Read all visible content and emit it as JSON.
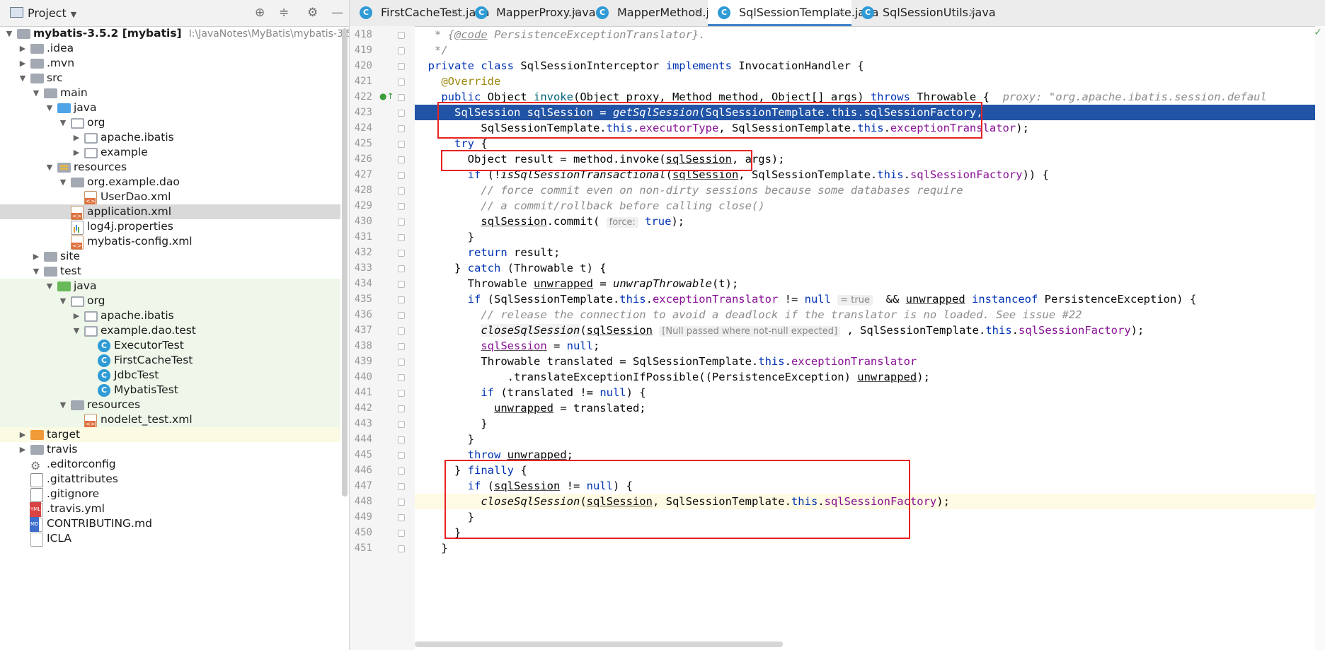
{
  "project_panel": {
    "title": "Project",
    "tree": [
      {
        "label": "mybatis-3.5.2 [mybatis]",
        "extra": "I:\\JavaNotes\\MyBatis\\mybatis-3.5.",
        "depth": 0,
        "state": "open",
        "icon": "module-folder-icon"
      },
      {
        "label": ".idea",
        "depth": 1,
        "state": "closed",
        "icon": "folder-icon"
      },
      {
        "label": ".mvn",
        "depth": 1,
        "state": "closed",
        "icon": "folder-icon"
      },
      {
        "label": "src",
        "depth": 1,
        "state": "open",
        "icon": "folder-icon"
      },
      {
        "label": "main",
        "depth": 2,
        "state": "open",
        "icon": "folder-icon"
      },
      {
        "label": "java",
        "depth": 3,
        "state": "open",
        "icon": "source-folder-icon"
      },
      {
        "label": "org",
        "depth": 4,
        "state": "open",
        "icon": "package-icon"
      },
      {
        "label": "apache.ibatis",
        "depth": 5,
        "state": "closed",
        "icon": "package-icon"
      },
      {
        "label": "example",
        "depth": 5,
        "state": "closed",
        "icon": "package-icon"
      },
      {
        "label": "resources",
        "depth": 3,
        "state": "open",
        "icon": "resources-folder-icon"
      },
      {
        "label": "org.example.dao",
        "depth": 4,
        "state": "open",
        "icon": "folder-icon"
      },
      {
        "label": "UserDao.xml",
        "depth": 5,
        "state": "leaf",
        "icon": "xml-file-icon"
      },
      {
        "label": "application.xml",
        "depth": 4,
        "state": "leaf",
        "icon": "xml-file-icon",
        "selected": true
      },
      {
        "label": "log4j.properties",
        "depth": 4,
        "state": "leaf",
        "icon": "properties-file-icon"
      },
      {
        "label": "mybatis-config.xml",
        "depth": 4,
        "state": "leaf",
        "icon": "xml-file-icon"
      },
      {
        "label": "site",
        "depth": 2,
        "state": "closed",
        "icon": "folder-icon"
      },
      {
        "label": "test",
        "depth": 2,
        "state": "open",
        "icon": "folder-icon"
      },
      {
        "label": "java",
        "depth": 3,
        "state": "open",
        "icon": "test-folder-icon",
        "green": true
      },
      {
        "label": "org",
        "depth": 4,
        "state": "open",
        "icon": "package-icon",
        "green": true
      },
      {
        "label": "apache.ibatis",
        "depth": 5,
        "state": "closed",
        "icon": "package-icon",
        "green": true
      },
      {
        "label": "example.dao.test",
        "depth": 5,
        "state": "open",
        "icon": "package-icon",
        "green": true
      },
      {
        "label": "ExecutorTest",
        "depth": 6,
        "state": "leaf",
        "icon": "class-icon",
        "green": true
      },
      {
        "label": "FirstCacheTest",
        "depth": 6,
        "state": "leaf",
        "icon": "class-icon",
        "green": true
      },
      {
        "label": "JdbcTest",
        "depth": 6,
        "state": "leaf",
        "icon": "class-icon",
        "green": true
      },
      {
        "label": "MybatisTest",
        "depth": 6,
        "state": "leaf",
        "icon": "class-icon",
        "green": true
      },
      {
        "label": "resources",
        "depth": 4,
        "state": "open",
        "icon": "folder-icon",
        "green": true
      },
      {
        "label": "nodelet_test.xml",
        "depth": 5,
        "state": "leaf",
        "icon": "xml-file-icon",
        "green": true
      },
      {
        "label": "target",
        "depth": 1,
        "state": "closed",
        "icon": "excluded-folder-icon",
        "yellow": true
      },
      {
        "label": "travis",
        "depth": 1,
        "state": "closed",
        "icon": "folder-icon"
      },
      {
        "label": ".editorconfig",
        "depth": 1,
        "state": "leaf",
        "icon": "gear-icon"
      },
      {
        "label": ".gitattributes",
        "depth": 1,
        "state": "leaf",
        "icon": "git-file-icon"
      },
      {
        "label": ".gitignore",
        "depth": 1,
        "state": "leaf",
        "icon": "git-file-icon"
      },
      {
        "label": ".travis.yml",
        "depth": 1,
        "state": "leaf",
        "icon": "yml-file-icon"
      },
      {
        "label": "CONTRIBUTING.md",
        "depth": 1,
        "state": "leaf",
        "icon": "md-file-icon"
      },
      {
        "label": "ICLA",
        "depth": 1,
        "state": "leaf",
        "icon": "text-file-icon"
      }
    ]
  },
  "tabs": [
    {
      "label": "FirstCacheTest.java",
      "active": false
    },
    {
      "label": "MapperProxy.java",
      "active": false
    },
    {
      "label": "MapperMethod.java",
      "active": false
    },
    {
      "label": "SqlSessionTemplate.java",
      "active": true
    },
    {
      "label": "SqlSessionUtils.java",
      "active": false
    }
  ],
  "code_lines": [
    {
      "n": "418",
      "html": "   <span class='doc'>* {</span><span class='docref'>@code</span><span class='doc'> PersistenceExceptionTranslator}.</span>"
    },
    {
      "n": "419",
      "html": "   <span class='doc'>*/</span>"
    },
    {
      "n": "420",
      "html": "  <span class='kw'>private class</span> SqlSessionInterceptor <span class='kw'>implements</span> InvocationHandler {"
    },
    {
      "n": "421",
      "html": "    <span class='an'>@Override</span>"
    },
    {
      "n": "422",
      "html": "    <span class='kw'>public</span> Object <span style='color:#00627a'>invoke</span>(Object proxy, Method method, Object[] args) <span class='kw'>throws</span> Throwable {  <span class='inl'>proxy: \"org.apache.ibatis.session.defaul</span>"
    },
    {
      "n": "423",
      "html": "      SqlSession <span class='u'>sqlSession</span> = <span class='it'>getSqlSession</span>(SqlSessionTemplate.this.sqlSessionFactory,",
      "hl": true
    },
    {
      "n": "424",
      "html": "          SqlSessionTemplate.<span class='kw'>this</span>.<span class='fld'>executorType</span>, SqlSessionTemplate.<span class='kw'>this</span>.<span class='fld'>exceptionTranslator</span>);"
    },
    {
      "n": "425",
      "html": "      <span class='kw'>try</span> {"
    },
    {
      "n": "426",
      "html": "        Object result = method.invoke(<span class='u'>sqlSession</span>, args);"
    },
    {
      "n": "427",
      "html": "        <span class='kw'>if</span> (!<span class='it'>isSqlSessionTransactional</span>(<span class='u'>sqlSession</span>, SqlSessionTemplate.<span class='kw'>this</span>.<span class='fld'>sqlSessionFactory</span>)) {"
    },
    {
      "n": "428",
      "html": "          <span class='cm'>// force commit even on non-dirty sessions because some databases require</span>"
    },
    {
      "n": "429",
      "html": "          <span class='cm'>// a commit/rollback before calling close()</span>"
    },
    {
      "n": "430",
      "html": "          <span class='u'>sqlSession</span>.commit( <span class='hint'>force:</span> <span class='kw'>true</span>);"
    },
    {
      "n": "431",
      "html": "        }"
    },
    {
      "n": "432",
      "html": "        <span class='kw'>return</span> result;"
    },
    {
      "n": "433",
      "html": "      } <span class='kw'>catch</span> (Throwable t) {"
    },
    {
      "n": "434",
      "html": "        Throwable <span class='u'>unwrapped</span> = <span class='it'>unwrapThrowable</span>(t);"
    },
    {
      "n": "435",
      "html": "        <span class='kw'>if</span> (SqlSessionTemplate.<span class='kw'>this</span>.<span class='fld'>exceptionTranslator</span> != <span class='kw'>null</span> <span class='hint'>= true</span>  &amp;&amp; <span class='u'>unwrapped</span> <span class='kw'>instanceof</span> PersistenceException) {"
    },
    {
      "n": "436",
      "html": "          <span class='cm'>// release the connection to avoid a deadlock if the translator is no loaded. See issue #22</span>"
    },
    {
      "n": "437",
      "html": "          <span class='it' style='background:#f2f2f2'>closeSqlSession</span>(<span class='u'>sqlSession</span> <span class='hint'>[Null passed where not-null expected]</span> , SqlSessionTemplate.<span class='kw'>this</span>.<span class='fld'>sqlSessionFactory</span>);"
    },
    {
      "n": "438",
      "html": "          <span class='u fld'>sqlSession</span> = <span class='kw'>null</span>;"
    },
    {
      "n": "439",
      "html": "          Throwable translated = SqlSessionTemplate.<span class='kw'>this</span>.<span class='fld'>exceptionTranslator</span>"
    },
    {
      "n": "440",
      "html": "              .translateExceptionIfPossible((PersistenceException) <span class='u'>unwrapped</span>);"
    },
    {
      "n": "441",
      "html": "          <span class='kw'>if</span> (translated != <span class='kw'>null</span>) {"
    },
    {
      "n": "442",
      "html": "            <span class='u'>unwrapped</span> = translated;"
    },
    {
      "n": "443",
      "html": "          }"
    },
    {
      "n": "444",
      "html": "        }"
    },
    {
      "n": "445",
      "html": "        <span class='kw'>throw</span> <span class='u'>unwrapped</span>;"
    },
    {
      "n": "446",
      "html": "      } <span class='kw'>finally</span> {"
    },
    {
      "n": "447",
      "html": "        <span class='kw'>if</span> (<span class='u'>sqlSession</span> != <span class='kw'>null</span>) {"
    },
    {
      "n": "448",
      "html": "          <span class='it'>closeSqlSession</span>(<span class='u'>sqlSession</span>, SqlSessionTemplate.<span class='kw'>this</span>.<span class='fld'>sqlSessionFactory</span>);",
      "caret": true
    },
    {
      "n": "449",
      "html": "        }"
    },
    {
      "n": "450",
      "html": "      }"
    },
    {
      "n": "451",
      "html": "    }"
    }
  ]
}
